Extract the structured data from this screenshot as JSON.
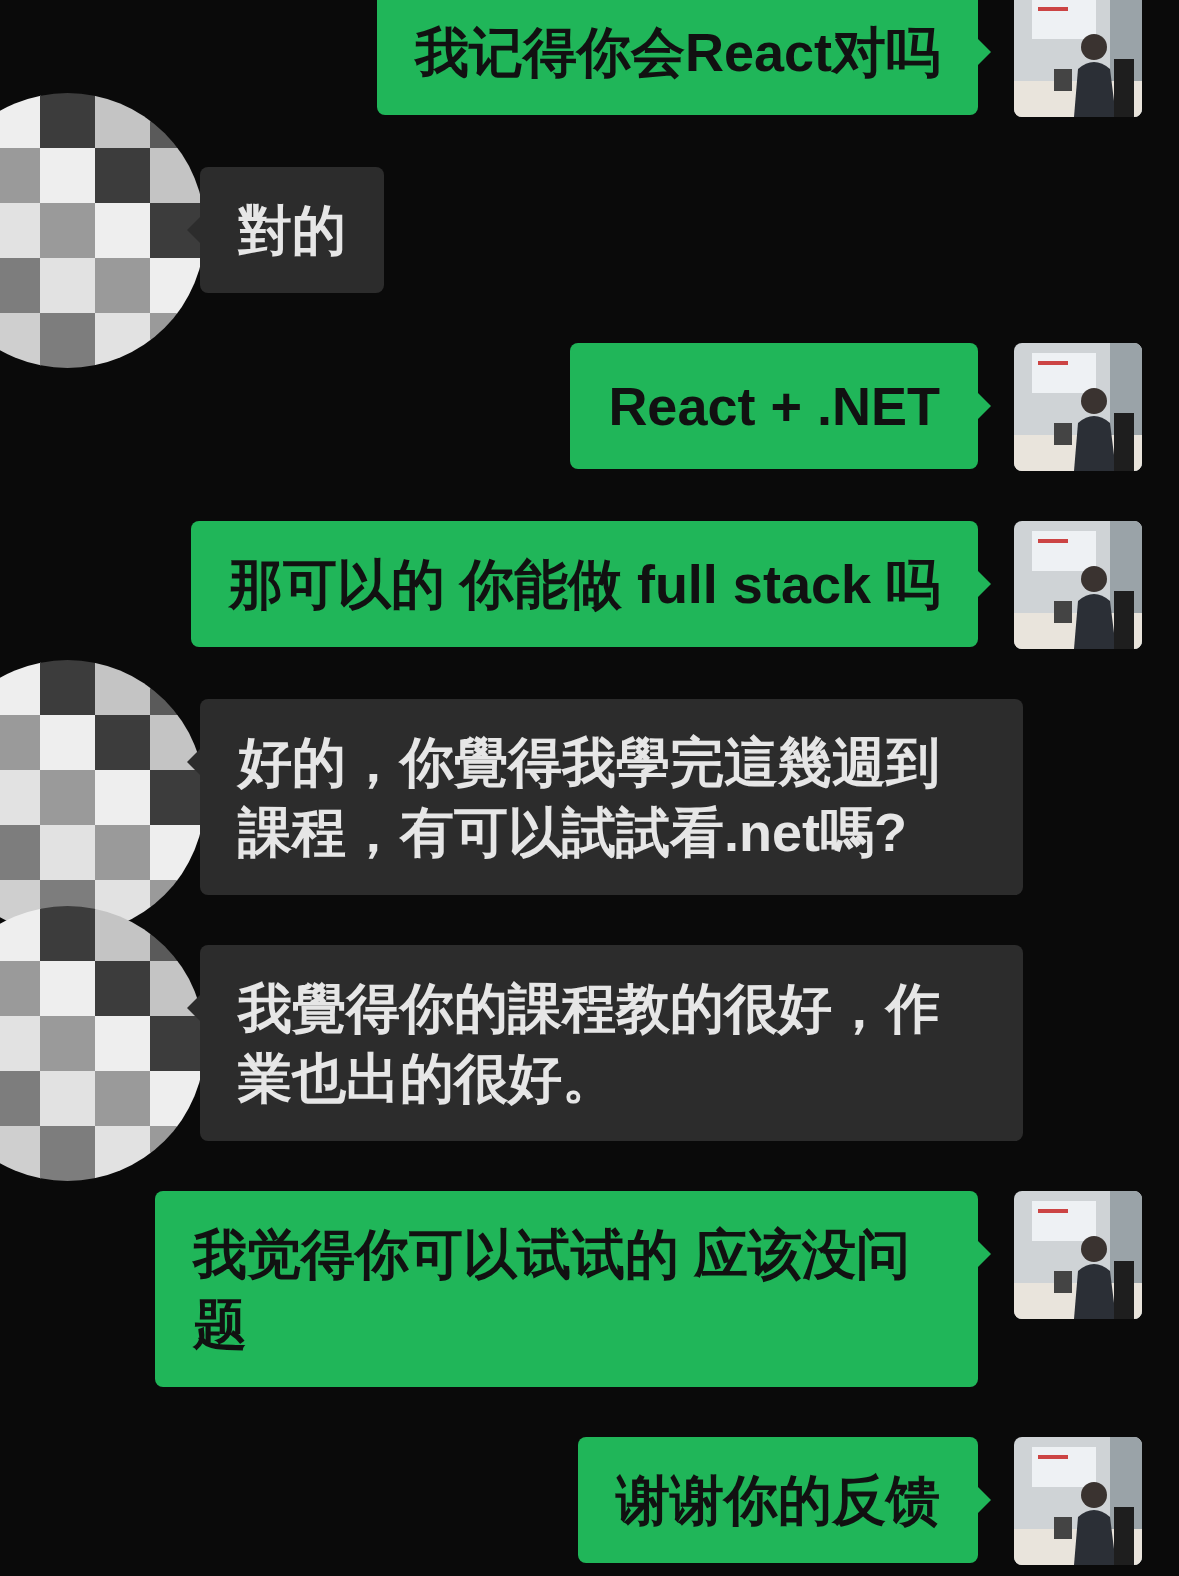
{
  "messages": [
    {
      "kind": "sent",
      "text": "我记得你会React对吗"
    },
    {
      "kind": "received",
      "text": "對的"
    },
    {
      "kind": "sent",
      "text": "React + .NET"
    },
    {
      "kind": "sent",
      "text": "那可以的 你能做 full stack 吗"
    },
    {
      "kind": "received",
      "text": "好的，你覺得我學完這幾週到課程，有可以試試看.net嗎?"
    },
    {
      "kind": "received",
      "text": "我覺得你的課程教的很好，作業也出的很好。"
    },
    {
      "kind": "sent",
      "text": "我觉得你可以试试的 应该没问题"
    },
    {
      "kind": "sent",
      "text": "谢谢你的反馈"
    }
  ]
}
